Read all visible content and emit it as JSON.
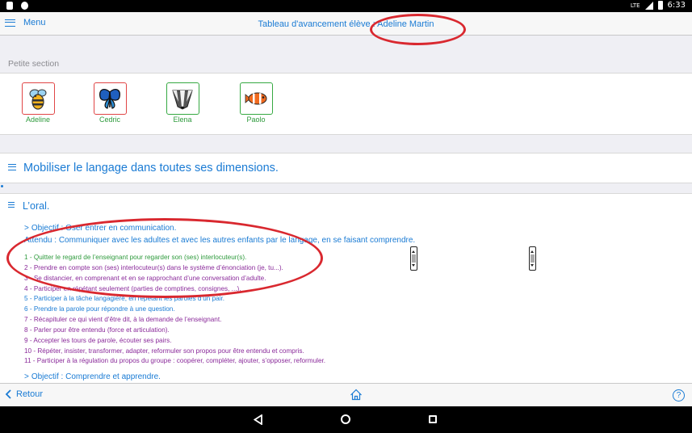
{
  "status_bar": {
    "time": "6:33",
    "network": "LTE"
  },
  "header": {
    "menu_label": "Menu",
    "title": "Tableau d'avancement élève : Adeline Martin"
  },
  "section": {
    "label": "Petite section"
  },
  "students": [
    {
      "name": "Adeline",
      "icon": "bee-icon"
    },
    {
      "name": "Cedric",
      "icon": "butterfly-icon"
    },
    {
      "name": "Elena",
      "icon": "badger-icon"
    },
    {
      "name": "Paolo",
      "icon": "clownfish-icon"
    }
  ],
  "domain": {
    "title": "Mobiliser le langage dans toutes ses dimensions."
  },
  "subdomain": {
    "title": "L’oral."
  },
  "objective1": {
    "prefix": "Objectif : ",
    "text": "Oser entrer en communication."
  },
  "attendu": {
    "prefix": "Attendu : ",
    "text": "Communiquer avec les adultes et avec les autres enfants par le langage, en se faisant comprendre."
  },
  "items": [
    {
      "text": "1 - Quitter le regard de l’enseignant pour regarder son (ses) interlocuteur(s).",
      "color": "#2e9a3c"
    },
    {
      "text": "2 - Prendre en compte son (ses) interlocuteur(s) dans le système d’énonciation (je, tu...).",
      "color": "#8a2a9a"
    },
    {
      "text": "3 - Se distancier, en comprenant et en se rapprochant d’une conversation d’adulte.",
      "color": "#8a2a9a"
    },
    {
      "text": "4 - Participer en répétant seulement (parties de comptines, consignes, ...).",
      "color": "#8a2a9a"
    },
    {
      "text": "5 - Participer à la tâche langagière, en répétant les paroles d’un pair.",
      "color": "#1a7bd4"
    },
    {
      "text": "6 - Prendre la parole pour répondre à une question.",
      "color": "#1a7bd4"
    },
    {
      "text": "7 - Récapituler ce qui vient d’être dit, à la demande de l’enseignant.",
      "color": "#8a2a9a"
    },
    {
      "text": "8 - Parler pour être entendu (force et articulation).",
      "color": "#8a2a9a"
    },
    {
      "text": "9 - Accepter les tours de parole, écouter ses pairs.",
      "color": "#8a2a9a"
    },
    {
      "text": "10 - Répéter, insister, transformer, adapter, reformuler son propos pour être entendu et compris.",
      "color": "#8a2a9a"
    },
    {
      "text": "11 - Participer à la régulation du propos du groupe : coopérer, compléter, ajouter, s’opposer, reformuler.",
      "color": "#8a2a9a"
    }
  ],
  "objective2": {
    "prefix": "Objectif : ",
    "text": "Comprendre et apprendre."
  },
  "footer": {
    "back_label": "Retour",
    "help_label": "?"
  },
  "colors": {
    "accent": "#1a7bd4",
    "annotation": "#d9282f"
  }
}
